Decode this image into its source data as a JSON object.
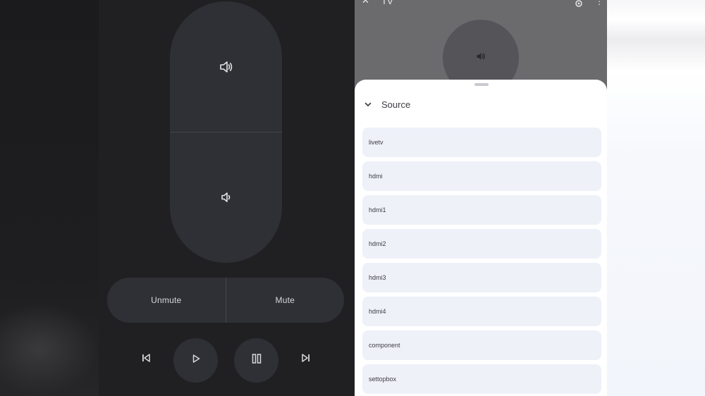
{
  "remote": {
    "mute_buttons": {
      "unmute_label": "Unmute",
      "mute_label": "Mute"
    }
  },
  "app": {
    "top_bar": {
      "close_glyph": "✕",
      "title": "TV",
      "more_glyph": "⋮"
    },
    "sheet": {
      "title": "Source",
      "sources": [
        "livetv",
        "hdmi",
        "hdmi1",
        "hdmi2",
        "hdmi3",
        "hdmi4",
        "component",
        "settopbox"
      ]
    }
  },
  "colors": {
    "remote_bg": "#202022",
    "control_bg": "#2f3035",
    "control_text": "#d7d8dc",
    "sheet_bg": "#ffffff",
    "source_item_bg": "#eef1f8",
    "sheet_text": "#3d3e43"
  },
  "icons": {
    "volume_up": "volume-up-icon",
    "volume_down": "volume-down-icon",
    "previous": "skip-previous-icon",
    "play": "play-icon",
    "pause": "pause-icon",
    "next": "skip-next-icon",
    "close": "close-icon",
    "settings": "gear-icon",
    "more": "more-vert-icon",
    "collapse": "chevron-down-icon"
  }
}
